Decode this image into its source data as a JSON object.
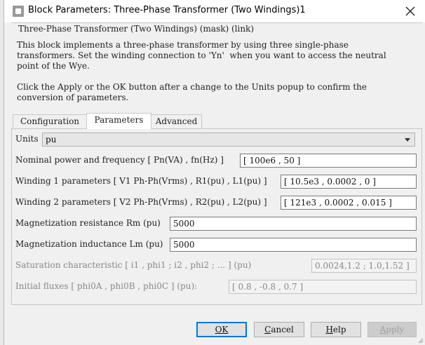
{
  "window": {
    "title": "Block Parameters: Three-Phase Transformer (Two Windings)1"
  },
  "mask": {
    "header": "Three-Phase Transformer (Two Windings) (mask) (link)",
    "description_lines": [
      "This block implements a three-phase transformer by using three single-phase",
      "transformers. Set the winding connection to 'Yn'  when you want to access the neutral",
      "point of the Wye."
    ],
    "note_lines": [
      "Click the Apply or the OK button after a change to the Units popup to confirm the",
      "conversion of parameters."
    ]
  },
  "tabs": [
    {
      "label": "Configuration",
      "active": false
    },
    {
      "label": "Parameters",
      "active": true
    },
    {
      "label": "Advanced",
      "active": false
    }
  ],
  "params": {
    "units": {
      "label": "Units",
      "value": "pu"
    },
    "nominal": {
      "label": "Nominal power and frequency  [ Pn(VA) , fn(Hz) ]",
      "value": "[ 100e6 , 50 ]"
    },
    "winding1": {
      "label": "Winding 1 parameters [ V1 Ph-Ph(Vrms) , R1(pu) , L1(pu) ]",
      "value": "[ 10.5e3 , 0.0002 , 0 ]"
    },
    "winding2": {
      "label": "Winding 2 parameters [ V2 Ph-Ph(Vrms) , R2(pu) , L2(pu) ]",
      "value": "[ 121e3 , 0.0002 , 0.015 ]"
    },
    "rm": {
      "label": "Magnetization resistance  Rm (pu)",
      "value": "5000"
    },
    "lm": {
      "label": "Magnetization inductance  Lm (pu)",
      "value": "5000"
    },
    "saturation": {
      "label": "Saturation characteristic [ i1 ,  phi1 ;  i2 , phi2 ; ... ] (pu)",
      "value": "0.0024,1.2 ; 1.0,1.52 ]"
    },
    "fluxes": {
      "label": "Initial fluxes [ phi0A , phi0B , phi0C ] (pu):",
      "value": "[ 0.8 , -0.8 , 0.7 ]"
    }
  },
  "buttons": {
    "ok": "OK",
    "cancel_first": "C",
    "cancel_rest": "ancel",
    "help_first": "H",
    "help_rest": "elp",
    "apply_first": "A",
    "apply_rest": "pply"
  },
  "icons": {
    "app": "simulink-block-icon",
    "close": "close-icon",
    "dropdown": "chevron-down-icon"
  }
}
